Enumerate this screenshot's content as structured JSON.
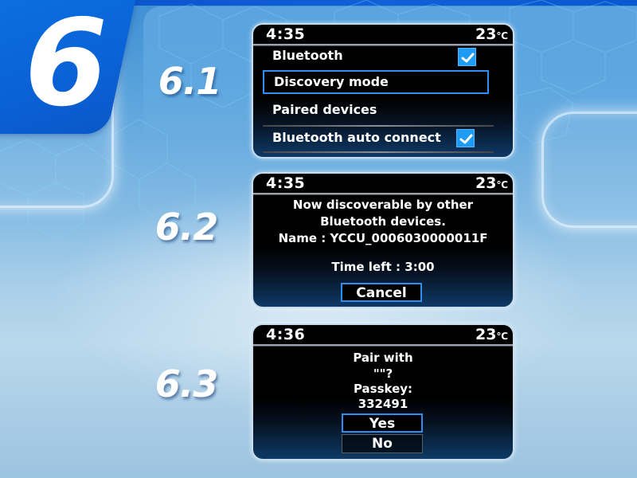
{
  "section": {
    "number": "6"
  },
  "steps": [
    {
      "label": "6.1",
      "screen": {
        "time": "4:35",
        "temperature": "23",
        "temperature_unit": "℃",
        "menu": [
          {
            "label": "Bluetooth",
            "checked": true,
            "focused": false
          },
          {
            "label": "Discovery mode",
            "checked": null,
            "focused": true
          },
          {
            "label": "Paired devices",
            "checked": null,
            "focused": false
          },
          {
            "label": "Bluetooth auto connect",
            "checked": true,
            "focused": false
          }
        ]
      }
    },
    {
      "label": "6.2",
      "screen": {
        "time": "4:35",
        "temperature": "23",
        "temperature_unit": "℃",
        "message_lines": [
          "Now discoverable by other",
          "Bluetooth devices.",
          "Name : YCCU_0006030000011F"
        ],
        "time_left": "Time left : 3:00",
        "buttons": [
          {
            "label": "Cancel",
            "focused": true
          }
        ]
      }
    },
    {
      "label": "6.3",
      "screen": {
        "time": "4:36",
        "temperature": "23",
        "temperature_unit": "℃",
        "message_lines": [
          "Pair with",
          "\"\"?",
          "Passkey:",
          "332491"
        ],
        "buttons": [
          {
            "label": "Yes",
            "focused": true
          },
          {
            "label": "No",
            "focused": false
          }
        ]
      }
    }
  ],
  "colors": {
    "accent_blue": "#2e8ff0",
    "checkbox_blue": "#1e9bf2",
    "badge_blue": "#0a62d6",
    "screen_bg": "#000000"
  },
  "icons": {
    "checkbox": "check-icon"
  }
}
